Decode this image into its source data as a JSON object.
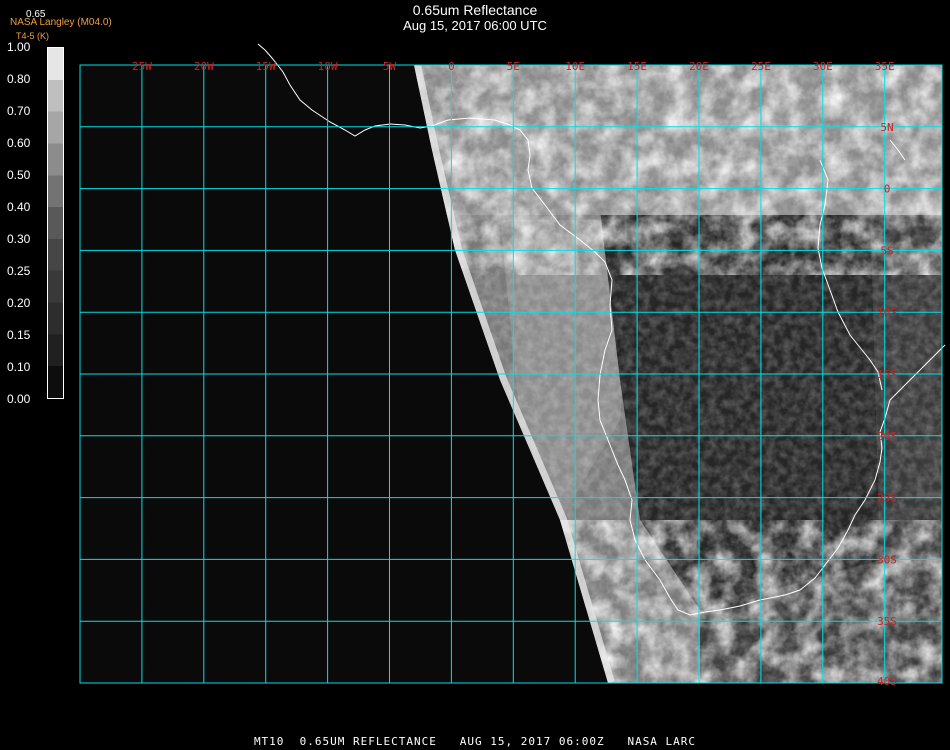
{
  "header": {
    "title": "0.65um Reflectance",
    "datetime": "Aug 15, 2017 06:00 UTC",
    "band_id": "0.65",
    "credit": "NASA Langley (M04.0)",
    "secondary_label": "T4-5 (K)"
  },
  "colorbar": {
    "labels": [
      "1.00",
      "0.80",
      "0.70",
      "0.60",
      "0.50",
      "0.40",
      "0.30",
      "0.25",
      "0.20",
      "0.15",
      "0.10",
      "0.00"
    ],
    "values": [
      1.0,
      0.8,
      0.7,
      0.6,
      0.5,
      0.4,
      0.3,
      0.25,
      0.2,
      0.15,
      0.1,
      0.0
    ]
  },
  "map": {
    "lon_labels": [
      "25W",
      "20W",
      "15W",
      "10W",
      "5W",
      "0",
      "5E",
      "10E",
      "15E",
      "20E",
      "25E",
      "30E",
      "35E"
    ],
    "lat_labels": [
      "5N",
      "0",
      "5S",
      "10S",
      "15S",
      "20S",
      "25S",
      "30S",
      "35S",
      "40S"
    ],
    "grid_color": "#00e0e8",
    "label_color": "#cc2222",
    "coast_color": "#ffffff",
    "background_color": "#0a0a0a"
  },
  "footer": {
    "text": "MT10  0.65UM REFLECTANCE   AUG 15, 2017 06:00Z   NASA LARC"
  }
}
